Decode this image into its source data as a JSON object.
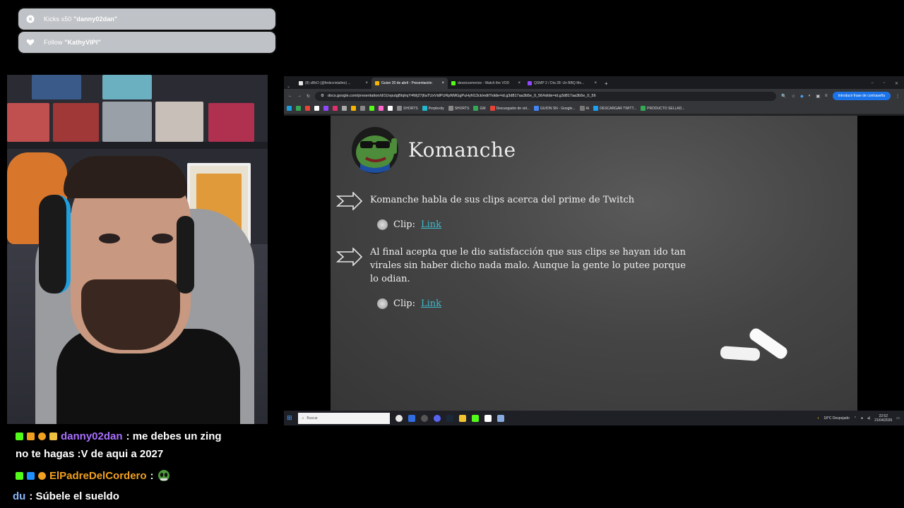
{
  "alerts": [
    {
      "icon": "x-circle-icon",
      "prefix": "Kicks x50 ",
      "name": "\"danny02dan\""
    },
    {
      "icon": "heart-icon",
      "prefix": "Follow ",
      "name": "\"KathyVIPI\""
    }
  ],
  "browser": {
    "tabs": [
      {
        "label": "(8) sBkO (@fedecristalino) ...",
        "color": "#e8e8e8"
      },
      {
        "label": "Guion 20 de abril - Presentación",
        "color": "#f4b400"
      },
      {
        "label": "dessicssmerize - Watch the VOD",
        "color": "#53fc18"
      },
      {
        "label": "QSMP 2 / Día 28: Un BBQ Mo...",
        "color": "#9146ff"
      }
    ],
    "new_tab": "+",
    "url": "docs.google.com/presentation/d/1UvputgBIqhqY4Wj27j6aTUxVidPURpNMGgPuHyN13ck/edit?slide=id.g3d817aa3b5e_0_56#slide=id.g3d817aa3b5e_0_56",
    "password_button": "Introducir frase de contraseña",
    "bookmarks": [
      {
        "label": "SHORTS",
        "color": "#888"
      },
      {
        "label": "Perplexity",
        "color": "#20b8cd"
      },
      {
        "label": "SHORTS",
        "color": "#888"
      },
      {
        "label": "GM",
        "color": "#34a853"
      },
      {
        "label": "Descargador de vid...",
        "color": "#ea4335"
      },
      {
        "label": "GUION SN - Google...",
        "color": "#4285f4"
      },
      {
        "label": "AI",
        "color": "#777"
      },
      {
        "label": "DESCARGAR TWITT...",
        "color": "#1da1f2"
      },
      {
        "label": "PRODUCTO SELLAD...",
        "color": "#34a853"
      }
    ]
  },
  "slide": {
    "title": "Komanche",
    "bullets": [
      {
        "text": "Komanche habla de sus clips acerca del prime de Twitch",
        "sub_label": "Clip:",
        "sub_link": "Link"
      },
      {
        "text": "Al final acepta que le dio satisfacción que sus clips se hayan ido tan virales sin haber dicho nada malo. Aunque la gente lo putee porque lo odian.",
        "sub_label": "Clip:",
        "sub_link": "Link"
      }
    ]
  },
  "taskbar": {
    "search_placeholder": "Buscar",
    "weather": "18°C Despejado",
    "time": "22:52",
    "date": "21/04/2026"
  },
  "chat": [
    {
      "user": "danny02dan",
      "user_color": "#a970ff",
      "message": ": me debes un zing"
    },
    {
      "continuation": "no te hagas :V de aqui a 2027"
    },
    {
      "user": "ElPadreDelCordero",
      "user_color": "#f0a020",
      "message": ":"
    },
    {
      "user": "du",
      "user_color": "#8ab4f8",
      "message": ": Súbele el sueldo"
    }
  ],
  "colors": {
    "kick_green": "#53fc18",
    "link": "#3fb8c9",
    "chalkboard": "#454545"
  }
}
